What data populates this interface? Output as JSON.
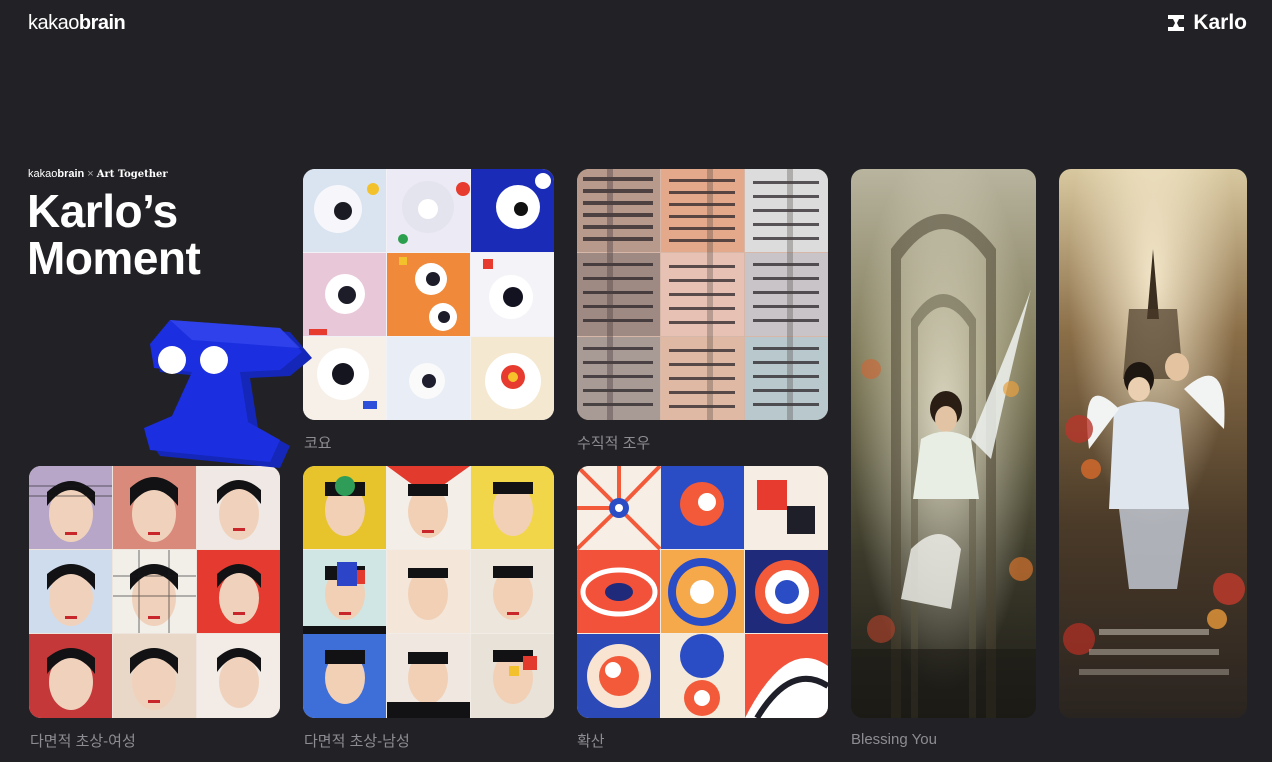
{
  "header": {
    "logo_prefix": "kakao",
    "logo_suffix": "brain",
    "brand_name": "Karlo"
  },
  "hero": {
    "sub_logo_prefix": "kakao",
    "sub_logo_suffix": "brain",
    "sub_separator": "×",
    "sub_partner": "Art Together",
    "title_line1": "Karlo’s",
    "title_line2": "Moment"
  },
  "gallery": [
    {
      "caption": "코요"
    },
    {
      "caption": "수직적 조우"
    },
    {
      "caption": "다면적 초상-여성"
    },
    {
      "caption": "다면적 초상-남성"
    },
    {
      "caption": "확산"
    },
    {
      "caption": "Blessing You"
    },
    {
      "caption": ""
    }
  ],
  "colors": {
    "background": "#222226",
    "caption": "#8c8c92",
    "mascot_blue": "#1c2fe0"
  }
}
